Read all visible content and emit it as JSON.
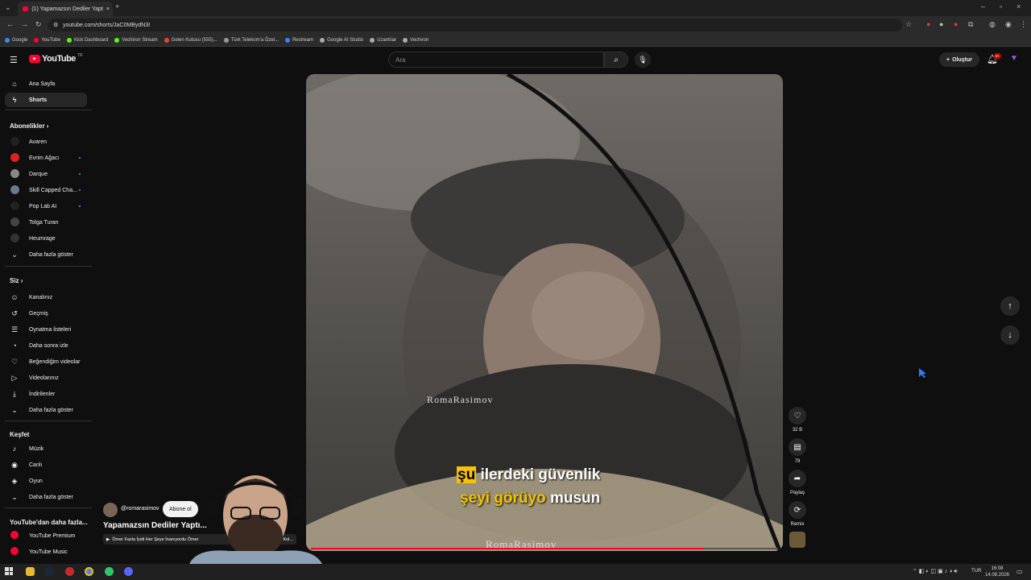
{
  "browser": {
    "tab_title": "(1) Yapamazsın Dediler Yapt",
    "url": "youtube.com/shorts/JaC0MBydN3I",
    "bookmarks": [
      {
        "label": "Google",
        "color": "#4285f4"
      },
      {
        "label": "YouTube",
        "color": "#ff0033"
      },
      {
        "label": "Kick Dashboard",
        "color": "#53fc18"
      },
      {
        "label": "Vechiron Stream",
        "color": "#53fc18"
      },
      {
        "label": "Gelen Kutusu (555)...",
        "color": "#ea4335"
      },
      {
        "label": "Türk Telekom'a Özel...",
        "color": "#999999"
      },
      {
        "label": "Restream",
        "color": "#3b82f6"
      },
      {
        "label": "Google AI Studio",
        "color": "#aaaaaa"
      },
      {
        "label": "Uzantılar",
        "color": "#aaaaaa"
      },
      {
        "label": "Vechiron",
        "color": "#aaaaaa"
      }
    ]
  },
  "header": {
    "logo_text": "YouTube",
    "logo_sup": "TR",
    "search_placeholder": "Ara",
    "create_label": "Oluştur",
    "notif_count": "9+"
  },
  "sidebar": {
    "main": [
      {
        "label": "Ana Sayfa",
        "icon": "home-icon",
        "glyph": "⌂"
      },
      {
        "label": "Shorts",
        "icon": "shorts-icon",
        "glyph": "ϟ"
      }
    ],
    "subs_title": "Abonelikler",
    "subs": [
      {
        "label": "Avaren",
        "color": "#222222"
      },
      {
        "label": "Evrim Ağacı",
        "color": "#d22"
      },
      {
        "label": "Darque",
        "color": "#888"
      },
      {
        "label": "Skill Capped Cha...",
        "color": "#6a7a8a"
      },
      {
        "label": "Pop Lab AI",
        "color": "#222"
      },
      {
        "label": "Tolga Turan",
        "color": "#444"
      },
      {
        "label": "Heumrage",
        "color": "#333"
      }
    ],
    "subs_more": "Daha fazla göster",
    "you_title": "Siz",
    "you": [
      {
        "label": "Kanalınız",
        "glyph": "☺"
      },
      {
        "label": "Geçmiş",
        "glyph": "↺"
      },
      {
        "label": "Oynatma listeleri",
        "glyph": "☰"
      },
      {
        "label": "Daha sonra izle",
        "glyph": "◔"
      },
      {
        "label": "Beğendiğim videolar",
        "glyph": "♡"
      },
      {
        "label": "Videolarınız",
        "glyph": "▷"
      },
      {
        "label": "İndirilenler",
        "glyph": "⤓"
      }
    ],
    "you_more": "Daha fazla göster",
    "explore_title": "Keşfet",
    "explore": [
      {
        "label": "Müzik",
        "glyph": "♪"
      },
      {
        "label": "Canlı",
        "glyph": "◉"
      },
      {
        "label": "Oyun",
        "glyph": "◈"
      }
    ],
    "explore_more": "Daha fazla göster",
    "more_title": "YouTube'dan daha fazla...",
    "more": [
      {
        "label": "YouTube Premium"
      },
      {
        "label": "YouTube Music"
      }
    ]
  },
  "video": {
    "channel": "@romarasimov",
    "subscribe": "Abone ol",
    "title": "Yapamazsın Dediler Yaptı...",
    "playlist_text": "Ömer Fazla İyidi Her Şeye İnanıyordu Ömer",
    "playlist_text_tail": "tek Kol...",
    "sub_line1_hl": "şu",
    "sub_line1": "ilerdeki güvenlik",
    "sub_line2_hl": "şeyi görüyo",
    "sub_line2": "musun",
    "watermark": "RomaRasimov",
    "watermark_bottom": "RomaRasimov",
    "progress": 0.84
  },
  "actions": {
    "like": "32 B",
    "comments": "79",
    "share": "Paylaş",
    "remix": "Remix"
  },
  "taskbar": {
    "lang": "TUR",
    "time": "16:08",
    "date": "14.08.2026"
  }
}
